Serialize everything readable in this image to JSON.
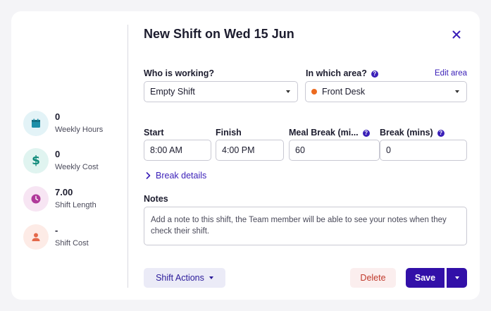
{
  "modal": {
    "title": "New Shift on Wed 15 Jun"
  },
  "stats": [
    {
      "value": "0",
      "label": "Weekly Hours",
      "icon": "calendar-icon",
      "color": "#1c8fa8"
    },
    {
      "value": "0",
      "label": "Weekly Cost",
      "icon": "dollar-icon",
      "color": "#0f8a7a"
    },
    {
      "value": "7.00",
      "label": "Shift Length",
      "icon": "clock-icon",
      "color": "#b0399a"
    },
    {
      "value": "-",
      "label": "Shift Cost",
      "icon": "person-icon",
      "color": "#e4684a"
    }
  ],
  "form": {
    "who_label": "Who is working?",
    "who_value": "Empty Shift",
    "area_label": "In which area?",
    "area_value": "Front Desk",
    "area_color": "#ec6a1f",
    "edit_area": "Edit area",
    "start_label": "Start",
    "start_value": "8:00 AM",
    "finish_label": "Finish",
    "finish_value": "4:00 PM",
    "meal_label": "Meal Break (mi...",
    "meal_value": "60",
    "break_label": "Break (mins)",
    "break_value": "0",
    "break_details": "Break details",
    "notes_label": "Notes",
    "notes_placeholder": "Add a note to this shift, the Team member will be able to see your notes when they check their shift."
  },
  "footer": {
    "actions_label": "Shift Actions",
    "delete_label": "Delete",
    "save_label": "Save"
  },
  "colors": {
    "accent": "#3210a8",
    "delete": "#c0392b"
  }
}
